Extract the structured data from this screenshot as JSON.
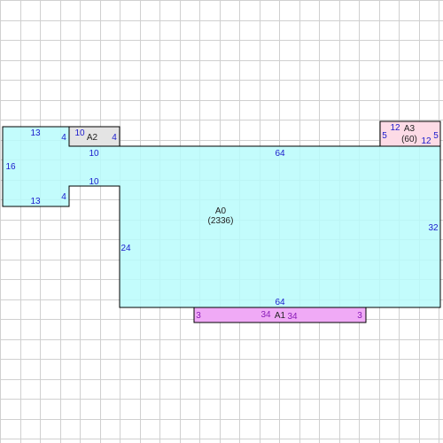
{
  "grid_color": "#d0d0d0",
  "edge_color": "#000000",
  "areas": {
    "a0": {
      "label": "A0",
      "value": "(2336)",
      "fill": "#b8fbfb"
    },
    "a1": {
      "label": "A1",
      "fill": "#f0aaf6"
    },
    "a2": {
      "label": "A2",
      "fill": "#e4e4e4"
    },
    "a3": {
      "label": "A3",
      "value": "(60)",
      "fill": "#fddbe6"
    }
  },
  "dims": {
    "a0": {
      "top_left": "10",
      "top_right": "64",
      "right": "32",
      "bottom": "64",
      "inner_left": "24",
      "step": "10",
      "notch": "4",
      "left_top": "13",
      "left_side": "16",
      "left_bottom": "13",
      "left_notch": "4"
    },
    "a1": {
      "left": "3",
      "top": "34",
      "bottom": "34",
      "right": "3"
    },
    "a2": {
      "top": "10",
      "right": "4"
    },
    "a3": {
      "left": "5",
      "top": "12",
      "bottom": "12",
      "right": "5"
    }
  }
}
